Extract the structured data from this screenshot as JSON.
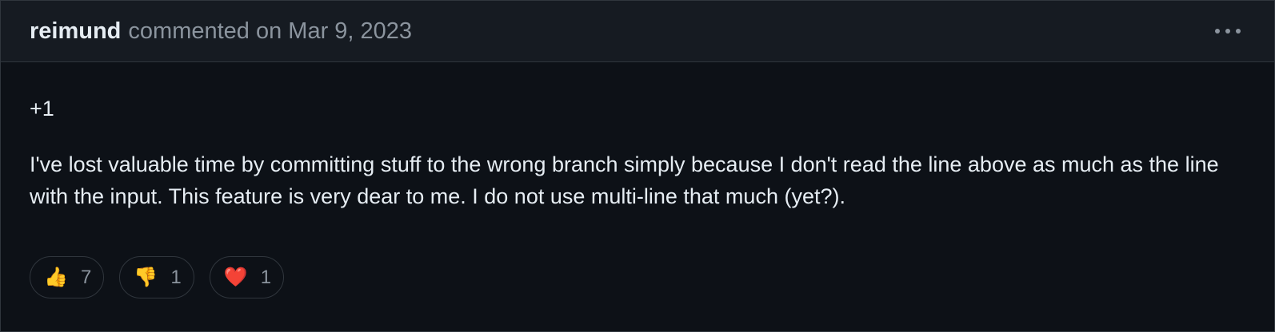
{
  "comment": {
    "author": "reimund",
    "meta": "commented on Mar 9, 2023",
    "more_icon": "kebab-horizontal-icon",
    "body": [
      "+1",
      "I've lost valuable time by committing stuff to the wrong branch simply because I don't read the line above as much as the line with the input. This feature is very dear to me. I do not use multi-line that much (yet?)."
    ],
    "reactions": [
      {
        "icon": "thumbs-up-icon",
        "emoji": "👍",
        "count": "7"
      },
      {
        "icon": "thumbs-down-icon",
        "emoji": "👎",
        "count": "1"
      },
      {
        "icon": "heart-icon",
        "emoji": "❤️",
        "count": "1"
      }
    ]
  },
  "colors": {
    "background": "#0d1117",
    "header_background": "#161b22",
    "border": "#30363d",
    "text": "#e6edf3",
    "muted": "#8b949e"
  }
}
